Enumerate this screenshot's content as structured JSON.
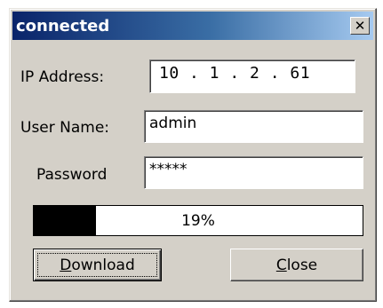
{
  "window": {
    "title": "connected",
    "close_glyph": "✕",
    "close_icon": "close-icon"
  },
  "form": {
    "ip_label": "IP Address:",
    "ip_value": "10 .  1 .  2 . 61",
    "username_label": "User Name:",
    "username_value": "admin",
    "password_label": "Password",
    "password_value": "*****"
  },
  "progress": {
    "percent": 19,
    "label": "19%"
  },
  "buttons": {
    "download_mnemonic": "D",
    "download_rest": "ownload",
    "close_mnemonic": "C",
    "close_rest": "lose"
  },
  "colors": {
    "titlebar_start": "#0a246a",
    "titlebar_end": "#a6caf0",
    "face": "#d4d0c8",
    "progress_fill": "#000000"
  }
}
